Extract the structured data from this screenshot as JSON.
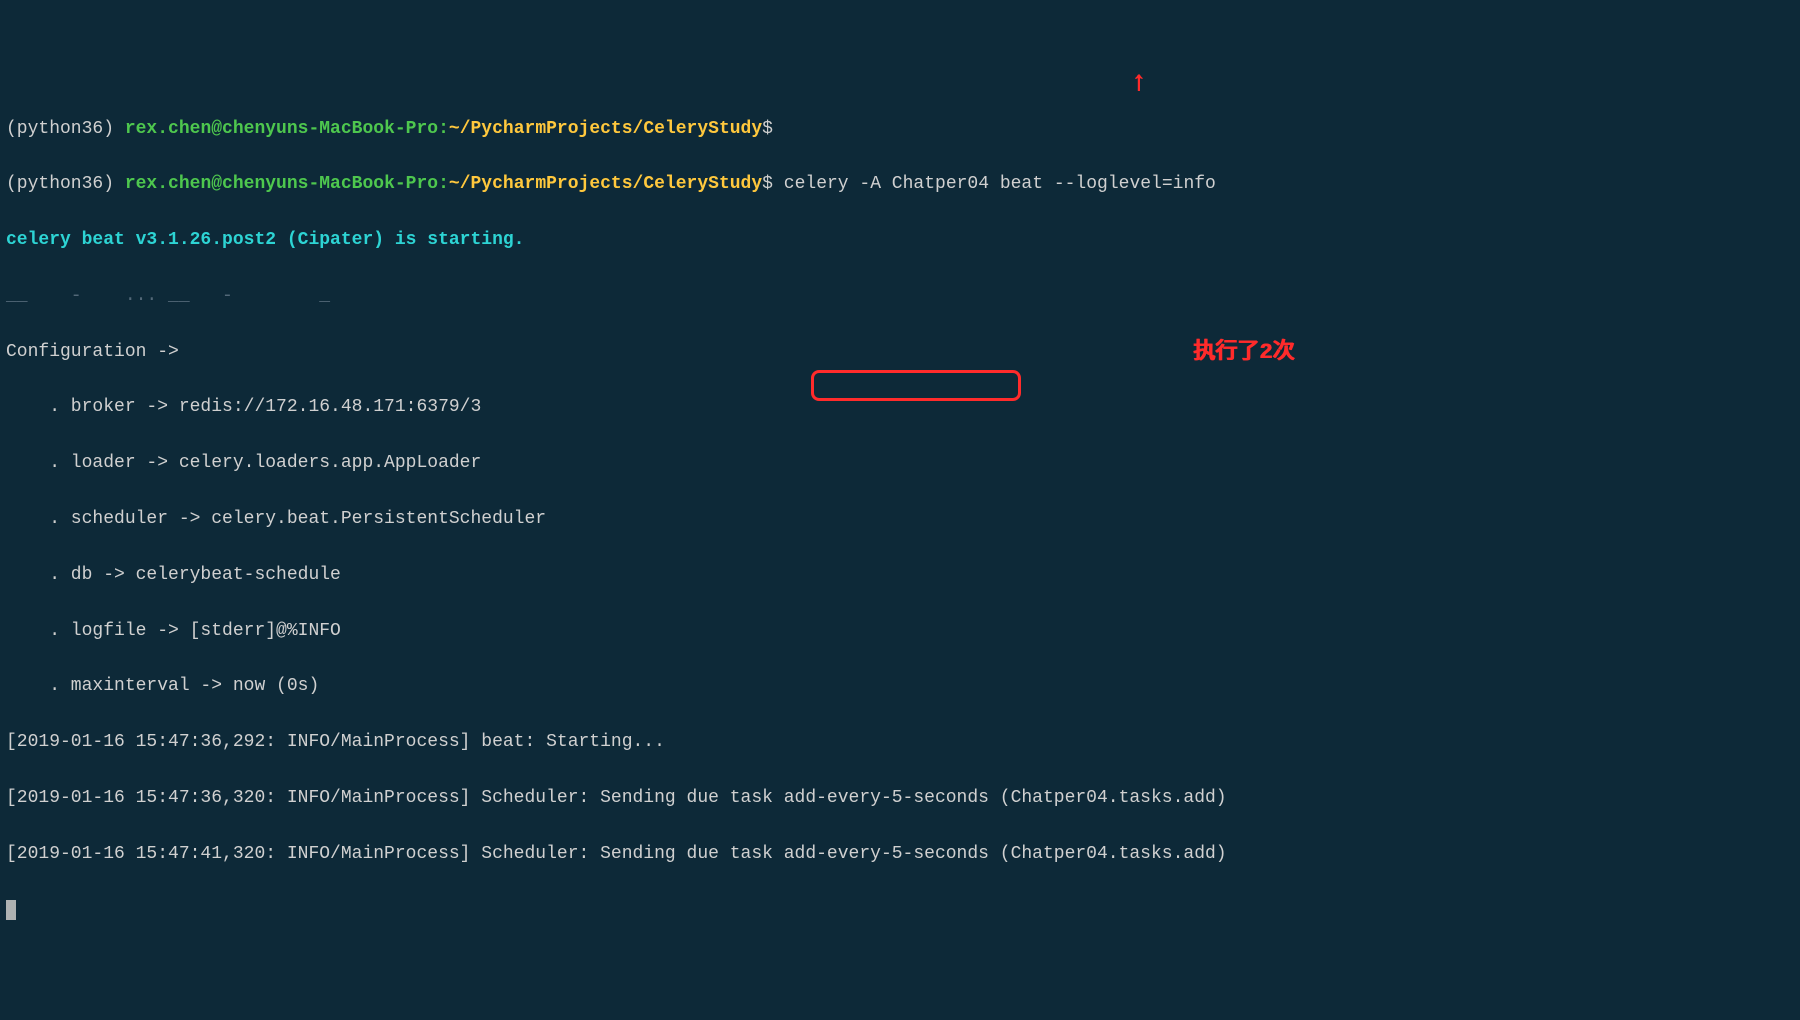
{
  "prompt1": {
    "venv": "(python36) ",
    "userhost": "rex.chen@chenyuns-MacBook-Pro",
    "colon": ":",
    "path": "~/PycharmProjects/CeleryStudy",
    "dollar": "$"
  },
  "prompt2": {
    "venv": "(python36) ",
    "userhost": "rex.chen@chenyuns-MacBook-Pro",
    "colon": ":",
    "path": "~/PycharmProjects/CeleryStudy",
    "dollar": "$",
    "command": " celery -A Chatper04 beat --loglevel=info"
  },
  "starting": "celery beat v3.1.26.post2 (Cipater) is starting.",
  "banner": {
    "l1": "__    -    ... __   -        _",
    "l2": "Configuration ->",
    "l3": "    . broker -> redis://172.16.48.171:6379/3",
    "l4": "    . loader -> celery.loaders.app.AppLoader",
    "l5": "    . scheduler -> celery.beat.PersistentScheduler",
    "l6": "    . db -> celerybeat-schedule",
    "l7": "    . logfile -> [stderr]@%INFO",
    "l8": "    . maxinterval -> now (0s)"
  },
  "log1": "[2019-01-16 15:47:36,292: INFO/MainProcess] beat: Starting...",
  "log2": "[2019-01-16 15:47:36,320: INFO/MainProcess] Scheduler: Sending due task add-every-5-seconds (Chatper04.tasks.add)",
  "log3": "[2019-01-16 15:47:41,320: INFO/MainProcess] Scheduler: Sending due task add-every-5-seconds (Chatper04.tasks.add)",
  "annotations": {
    "arrow": "↑",
    "exec_label": "执行了2次"
  }
}
